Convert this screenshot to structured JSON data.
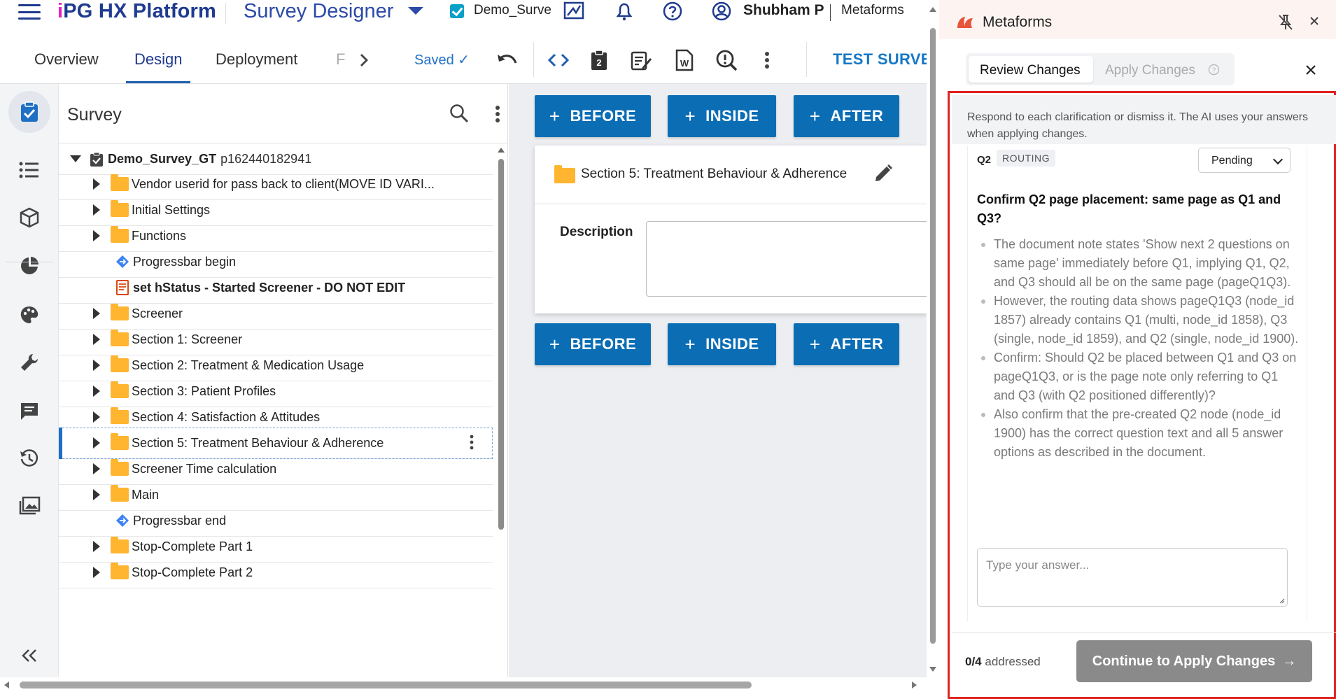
{
  "header": {
    "brand_mark": "i",
    "brand_text": "PG HX Platform",
    "app_title": "Survey Designer",
    "survey_name": "Demo_Survey_GT",
    "user_name": "Shubham P",
    "org_name": "Metaforms"
  },
  "tabs": [
    {
      "label": "Overview"
    },
    {
      "label": "Design"
    },
    {
      "label": "Deployment"
    },
    {
      "label": "F"
    }
  ],
  "toolbar": {
    "saved_label": "Saved ✓",
    "test_survey_label": "TEST SURVEY"
  },
  "tree": {
    "title": "Survey",
    "root_label": "Demo_Survey_GT",
    "root_id": "p162440182941",
    "items": [
      {
        "label": "Vendor userid for pass back to client(MOVE ID VARI...",
        "type": "folder"
      },
      {
        "label": "Initial Settings",
        "type": "folder"
      },
      {
        "label": "Functions",
        "type": "folder"
      },
      {
        "label": "Progressbar begin",
        "type": "progress"
      },
      {
        "label": "set hStatus - Started Screener - DO NOT EDIT",
        "type": "script"
      },
      {
        "label": "Screener",
        "type": "folder"
      },
      {
        "label": "Section 1: Screener",
        "type": "folder"
      },
      {
        "label": "Section 2: Treatment & Medication Usage",
        "type": "folder"
      },
      {
        "label": "Section 3: Patient Profiles",
        "type": "folder"
      },
      {
        "label": "Section 4: Satisfaction & Attitudes",
        "type": "folder"
      },
      {
        "label": "Section 5: Treatment Behaviour & Adherence",
        "type": "folder"
      },
      {
        "label": "Screener Time calculation",
        "type": "folder"
      },
      {
        "label": "Main",
        "type": "folder"
      },
      {
        "label": "Progressbar end",
        "type": "progress"
      },
      {
        "label": "Stop-Complete Part 1",
        "type": "folder"
      },
      {
        "label": "Stop-Complete Part 2",
        "type": "folder"
      }
    ]
  },
  "canvas": {
    "before_label": "BEFORE",
    "inside_label": "INSIDE",
    "after_label": "AFTER",
    "plus": "+",
    "section_title": "Section 5: Treatment Behaviour & Adherence",
    "description_label": "Description"
  },
  "panel": {
    "title": "Metaforms",
    "tab_review": "Review Changes",
    "tab_apply": "Apply Changes",
    "info_text": "Respond to each clarification or dismiss it. The AI uses your answers when applying changes.",
    "question": {
      "code": "Q2",
      "tag": "ROUTING",
      "status": "Pending",
      "title": "Confirm Q2 page placement: same page as Q1 and Q3?",
      "bullets": [
        "The document note states 'Show next 2 questions on same page' immediately before Q1, implying Q1, Q2, and Q3 should all be on the same page (pageQ1Q3).",
        "However, the routing data shows pageQ1Q3 (node_id 1857) already contains Q1 (multi, node_id 1858), Q3 (single, node_id 1859), and Q2 (single, node_id 1900).",
        "Confirm: Should Q2 be placed between Q1 and Q3 on pageQ1Q3, or is the page note only referring to Q1 and Q3 (with Q2 positioned differently)?",
        "Also confirm that the pre-created Q2 node (node_id 1900) has the correct question text and all 5 answer options as described in the document."
      ],
      "answer_placeholder": "Type your answer..."
    },
    "addressed_count": "0/4",
    "addressed_label": "addressed",
    "continue_label": "Continue to Apply Changes",
    "continue_arrow": "→"
  },
  "colors": {
    "brand": "#1f3b8f",
    "accent_blue": "#0b6eb5",
    "folder": "#ffb530",
    "highlight_frame": "#e02222"
  }
}
